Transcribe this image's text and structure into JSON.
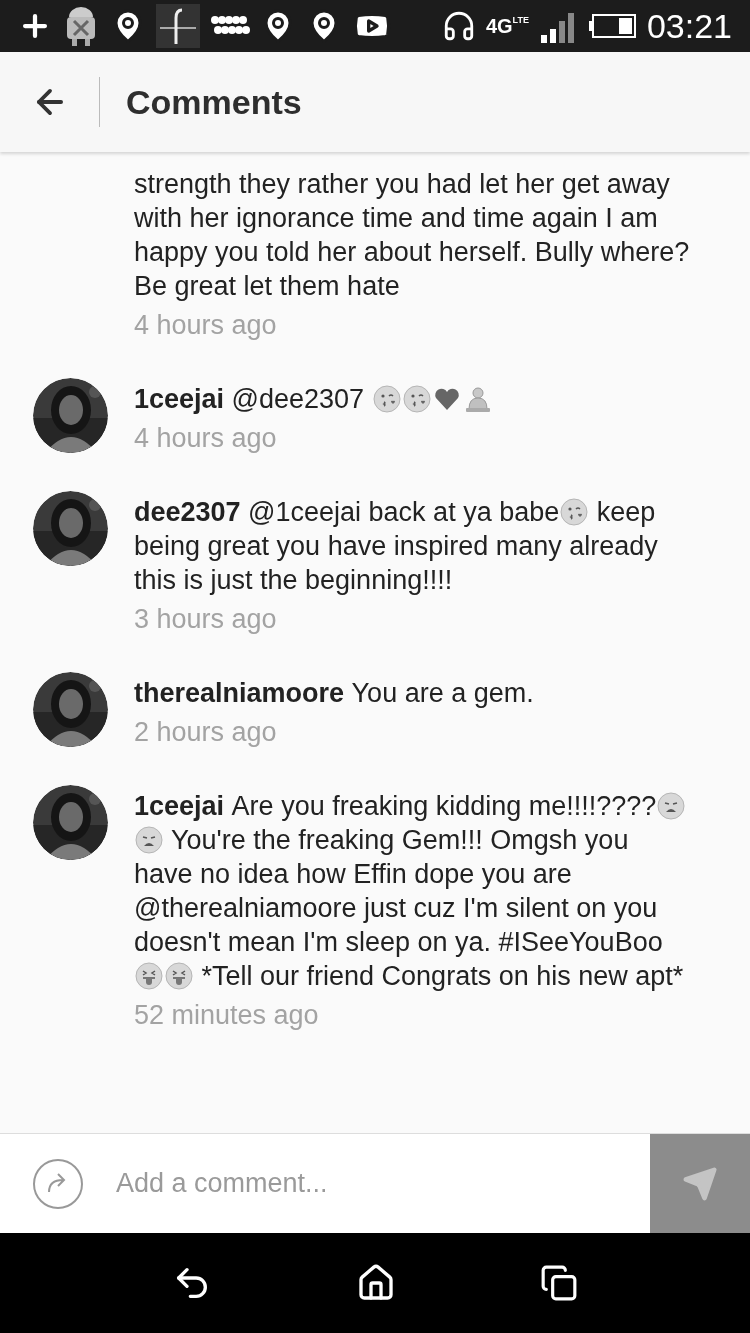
{
  "status_bar": {
    "network": "4G",
    "network_sub": "LTE",
    "time": "03:21"
  },
  "header": {
    "title": "Comments"
  },
  "comments": [
    {
      "body": [
        {
          "kind": "text",
          "text": "strength they rather you had let her get away with her ignorance time and time again I am happy you told her about herself. Bully where? Be great let them hate"
        }
      ],
      "time": "4 hours ago"
    },
    {
      "user": "1ceejai",
      "body": [
        {
          "kind": "text",
          "text": "@dee2307 "
        },
        {
          "kind": "kiss"
        },
        {
          "kind": "kiss"
        },
        {
          "kind": "heart"
        },
        {
          "kind": "figure"
        }
      ],
      "time": "4 hours ago"
    },
    {
      "user": "dee2307",
      "body": [
        {
          "kind": "text",
          "text": "@1ceejai back at ya babe"
        },
        {
          "kind": "kiss"
        },
        {
          "kind": "text",
          "text": " keep being great you have inspired many already this is just the beginning!!!!"
        }
      ],
      "time": "3 hours ago"
    },
    {
      "user": "therealniamoore",
      "body": [
        {
          "kind": "text",
          "text": "You are a gem."
        }
      ],
      "time": "2 hours ago"
    },
    {
      "user": "1ceejai",
      "body": [
        {
          "kind": "text",
          "text": "Are you freaking kidding me!!!!????"
        },
        {
          "kind": "weary"
        },
        {
          "kind": "weary"
        },
        {
          "kind": "text",
          "text": " You're the freaking Gem!!! Omgsh you have no idea how Effin dope you are @therealniamoore just cuz I'm silent on you doesn't mean I'm sleep on ya. #ISeeYouBoo "
        },
        {
          "kind": "tongue"
        },
        {
          "kind": "tongue"
        },
        {
          "kind": "text",
          "text": " *Tell our friend Congrats on his new apt*"
        }
      ],
      "time": "52 minutes ago"
    }
  ],
  "composer": {
    "placeholder": "Add a comment..."
  }
}
